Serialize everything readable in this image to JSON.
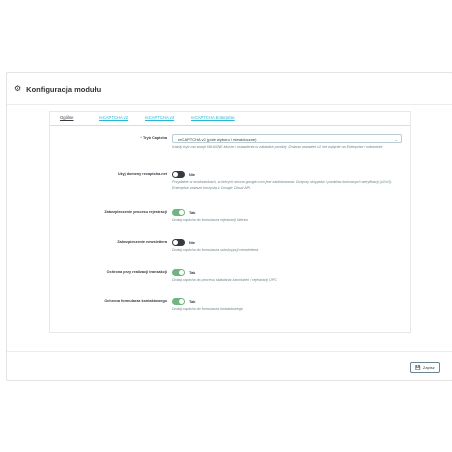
{
  "panel": {
    "title": "Konfiguracja modułu"
  },
  "tabs": [
    {
      "label": "Ogólne"
    },
    {
      "label": "reCAPTCHA v2"
    },
    {
      "label": "reCAPTCHA v3"
    },
    {
      "label": "reCAPTCHA Enterprise"
    }
  ],
  "fields": {
    "mode": {
      "required_mark": "*",
      "label": "Tryb Captcha",
      "value": "reCAPTCHA v2 (pole wyboru / niewidoczne)",
      "help": "Każdy tryb ma swoje WŁASNE klucze i ustawienia w zakładce poniżej. Zmiana ustawień v2 nie wpłynie na Enterprise i odwrotnie."
    },
    "recaptcha_net": {
      "label": "Użyj domeny recaptcha.net",
      "state": "Nie",
      "help": "Przydatne w środowiskach, w których strona google.com jest zablokowana. Dotyczy skryptów i punktów końcowych weryfikacji (v2/v3). Enterprise zawsze korzysta z Google Cloud API."
    },
    "registration": {
      "label": "Zabezpieczenie procesu rejestracji",
      "state": "Tak",
      "help": "Dodaj captcha do formularza rejestracji klienta"
    },
    "newsletter": {
      "label": "Zabezpieczenie newslettera",
      "state": "Nie",
      "help": "Dodaj captcha do formularza subskrypcji newslettera"
    },
    "checkout": {
      "label": "Ochrona przy realizacji transakcji",
      "state": "Tak",
      "help": "Dodaj captcha do procesu składania zamówień / rejestracji OPC"
    },
    "contact": {
      "label": "Ochrona formularza kontaktowego",
      "state": "Tak",
      "help": "Dodaj captcha do formularza kontaktowego"
    }
  },
  "footer": {
    "save_label": "Zapisz"
  }
}
